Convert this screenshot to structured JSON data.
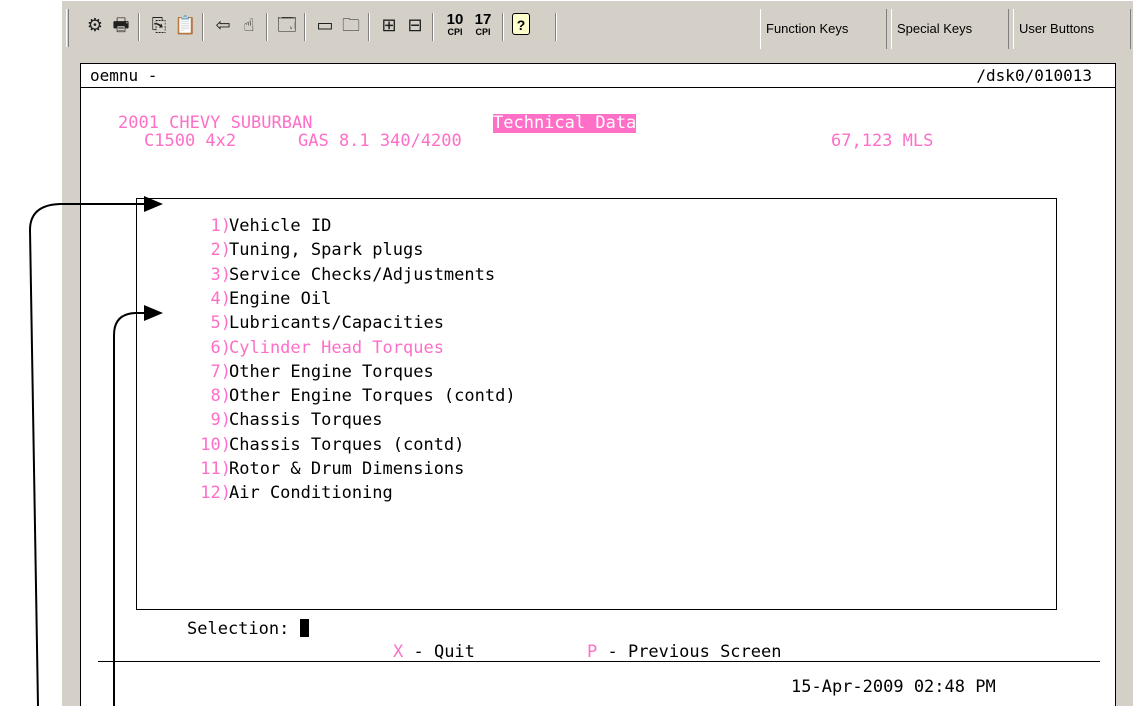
{
  "toolbar": {
    "icons": [
      "print-setup-icon",
      "print-icon",
      "copy-icon",
      "paste-icon",
      "back-icon",
      "find-icon",
      "properties-icon",
      "new-window-icon",
      "open-icon",
      "maximize-icon",
      "minimize-icon",
      "cpi-10-icon",
      "cpi-17-icon",
      "help-icon"
    ],
    "cpi10": {
      "num": "10",
      "unit": "CPI"
    },
    "cpi17": {
      "num": "17",
      "unit": "CPI"
    },
    "help_glyph": "?",
    "buttons": [
      "Function Keys",
      "Special Keys",
      "User Buttons"
    ]
  },
  "window": {
    "title_left": "oemnu -",
    "title_right": "/dsk0/010013"
  },
  "header": {
    "vehicle": "2001 CHEVY SUBURBAN",
    "section": "Technical Data",
    "model": "C1500 4x2",
    "engine": "GAS 8.1 340/4200",
    "mileage": "67,123 MLS"
  },
  "menu": [
    {
      "num": "1)",
      "label": "Vehicle ID"
    },
    {
      "num": "2)",
      "label": "Tuning, Spark plugs"
    },
    {
      "num": "3)",
      "label": "Service Checks/Adjustments"
    },
    {
      "num": "4)",
      "label": "Engine Oil"
    },
    {
      "num": "5)",
      "label": "Lubricants/Capacities"
    },
    {
      "num": "6)",
      "label": "Cylinder Head Torques"
    },
    {
      "num": "7)",
      "label": "Other Engine Torques"
    },
    {
      "num": "8)",
      "label": "Other Engine Torques (contd)"
    },
    {
      "num": "9)",
      "label": "Chassis Torques"
    },
    {
      "num": "10)",
      "label": "Chassis Torques (contd)"
    },
    {
      "num": "11)",
      "label": "Rotor & Drum Dimensions"
    },
    {
      "num": "12)",
      "label": "Air Conditioning"
    }
  ],
  "highlighted_item": 6,
  "selection": {
    "label": "Selection:"
  },
  "commands": {
    "quit_key": "X",
    "quit_label": " - Quit",
    "prev_key": "P",
    "prev_label": " - Previous Screen"
  },
  "status": {
    "datetime": "15-Apr-2009 02:48 PM"
  },
  "colors": {
    "accent": "#ff6ec7",
    "chrome": "#d4d0c8"
  }
}
